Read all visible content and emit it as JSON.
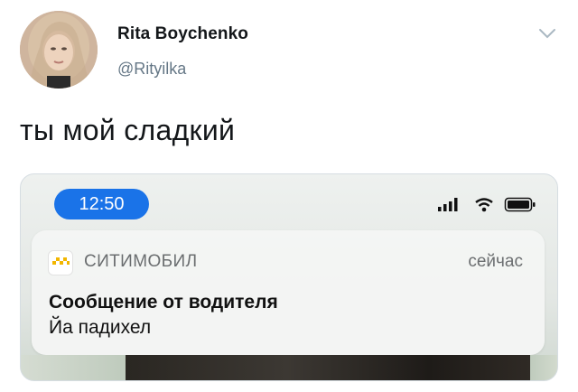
{
  "tweet": {
    "display_name": "Rita Boychenko",
    "handle": "@Rityilka",
    "text": "ты мой сладкий"
  },
  "screenshot": {
    "status_time": "12:50",
    "notification": {
      "app_name": "СИТИМОБИЛ",
      "time": "сейчас",
      "title": "Сообщение от водителя",
      "body": "Йа падихел"
    }
  },
  "icons": {
    "avatar": "user-avatar",
    "more": "chevron-down-icon",
    "signal": "cellular-signal-icon",
    "wifi": "wifi-icon",
    "battery": "battery-icon",
    "app": "citymobil-app-icon"
  },
  "colors": {
    "time_pill": "#1a73e8",
    "handle": "#657786",
    "app_icon_accent": "#f2b600"
  }
}
